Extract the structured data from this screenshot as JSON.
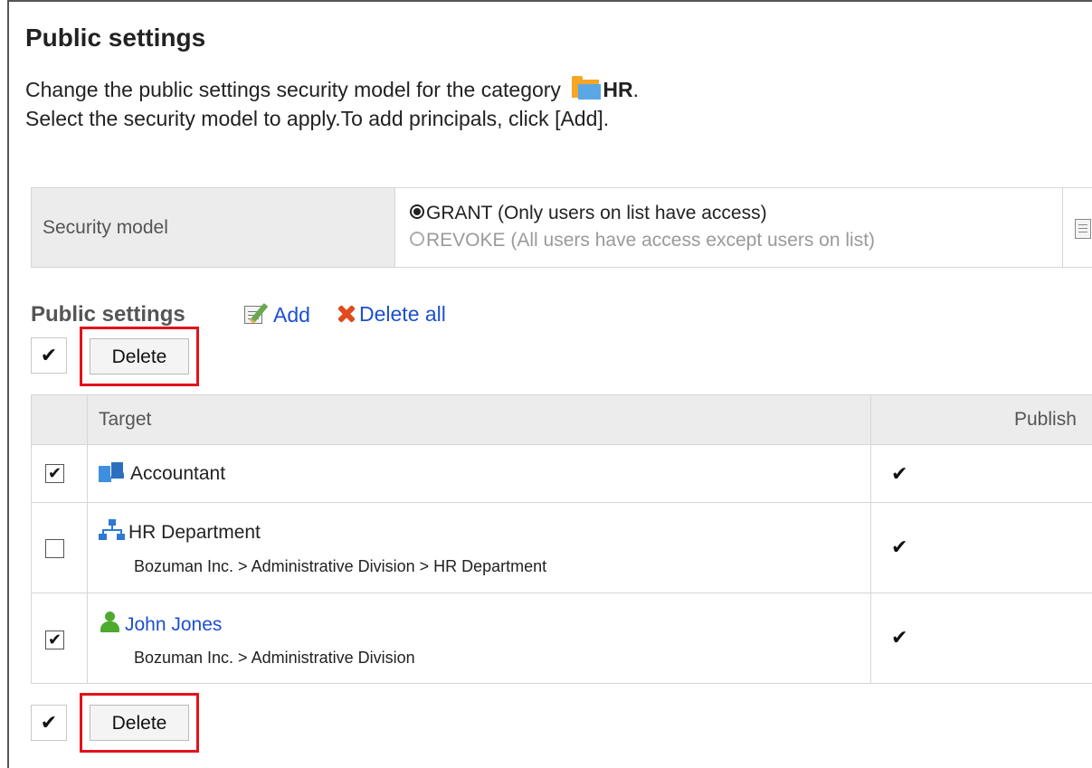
{
  "page": {
    "title": "Public settings",
    "description_prefix": "Change the public settings security model for the category ",
    "category_name": "HR",
    "description_suffix": ".",
    "instruction": "Select the security model to apply.To add principals, click [Add]."
  },
  "security_model": {
    "label": "Security model",
    "options": [
      {
        "label": "GRANT (Only users on list have access)",
        "selected": true
      },
      {
        "label": "REVOKE (All users have access except users on list)",
        "selected": false
      }
    ]
  },
  "public_settings": {
    "heading": "Public settings",
    "add_label": "Add",
    "delete_all_label": "Delete all",
    "check_all_symbol": "✔",
    "delete_button_label": "Delete"
  },
  "table": {
    "columns": {
      "target": "Target",
      "publish": "Publish"
    },
    "check_symbol": "✔",
    "rows": [
      {
        "type": "role",
        "name": "Accountant",
        "path": "",
        "checked": true,
        "publish": true
      },
      {
        "type": "organization",
        "name": "HR Department",
        "path": "Bozuman Inc. > Administrative Division > HR Department",
        "checked": false,
        "publish": true
      },
      {
        "type": "user",
        "name": "John Jones",
        "path": "Bozuman Inc. > Administrative Division",
        "checked": true,
        "publish": true
      }
    ]
  },
  "colors": {
    "link": "#1d4fd0",
    "highlight": "#e3121a",
    "header_bg": "#ececec"
  }
}
